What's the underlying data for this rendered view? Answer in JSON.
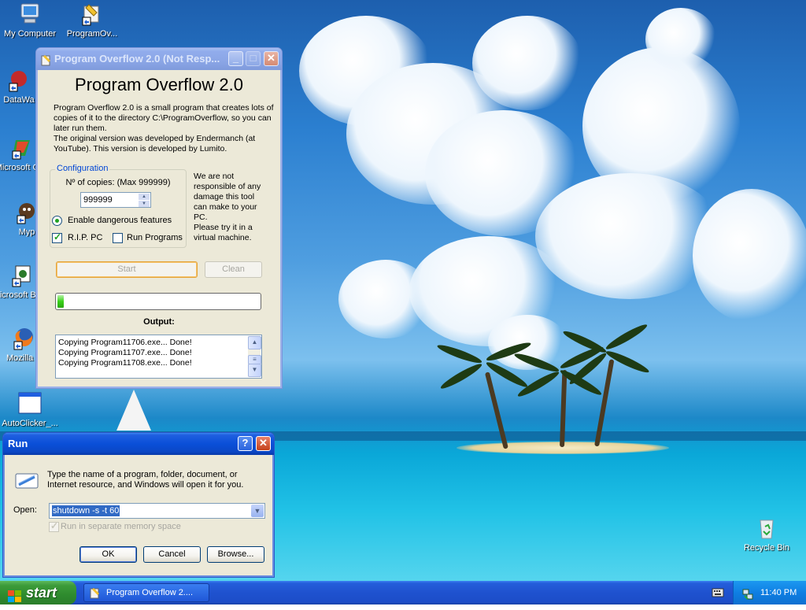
{
  "desktop": {
    "icons": [
      {
        "label": "My Computer"
      },
      {
        "label": "ProgramOv..."
      },
      {
        "label": "DataWa"
      },
      {
        "label": "Microsoft C++"
      },
      {
        "label": "Myp"
      },
      {
        "label": "Microsoft Basic"
      },
      {
        "label": "Mozilla F"
      },
      {
        "label": "AutoClicker_..."
      },
      {
        "label": "Recycle Bin"
      }
    ]
  },
  "program_overflow": {
    "title": "Program Overflow 2.0 (Not Resp...",
    "heading": "Program Overflow 2.0",
    "description": [
      "Program Overflow 2.0 is a small program that creates lots of copies of it to the directory C:\\ProgramOverflow, so you can later run them.",
      "The original version was developed by Endermanch (at YouTube). This version is developed by Lumito."
    ],
    "config": {
      "legend": "Configuration",
      "copies_label": "Nº of copies: (Max 999999)",
      "copies_value": "999999",
      "dangerous_label": "Enable dangerous features",
      "dangerous_selected": true,
      "rip_label": "R.I.P. PC",
      "rip_checked": true,
      "run_programs_label": "Run Programs",
      "run_programs_checked": false
    },
    "warning": "We are not responsible of any damage this tool can make to your PC.\nPlease try it in a virtual machine.",
    "start_label": "Start",
    "clean_label": "Clean",
    "progress_fraction": 0.03,
    "output_label": "Output:",
    "output_lines": [
      "Copying Program11706.exe... Done!",
      "Copying Program11707.exe... Done!",
      "Copying Program11708.exe... Done!"
    ]
  },
  "run_dialog": {
    "title": "Run",
    "help_glyph": "?",
    "instructions": "Type the name of a program, folder, document, or Internet resource, and Windows will open it for you.",
    "open_label": "Open:",
    "open_value": "shutdown -s -t 60",
    "separate_memory_label": "Run in separate memory space",
    "ok_label": "OK",
    "cancel_label": "Cancel",
    "browse_label": "Browse..."
  },
  "taskbar": {
    "start_label": "start",
    "task_label": "Program Overflow 2....",
    "clock": "11:40 PM"
  },
  "colors": {
    "title_active": "#0a4fd8",
    "title_inactive": "#8ba6e6",
    "start_green": "#3c9b3a",
    "taskbar_blue": "#245edb"
  }
}
